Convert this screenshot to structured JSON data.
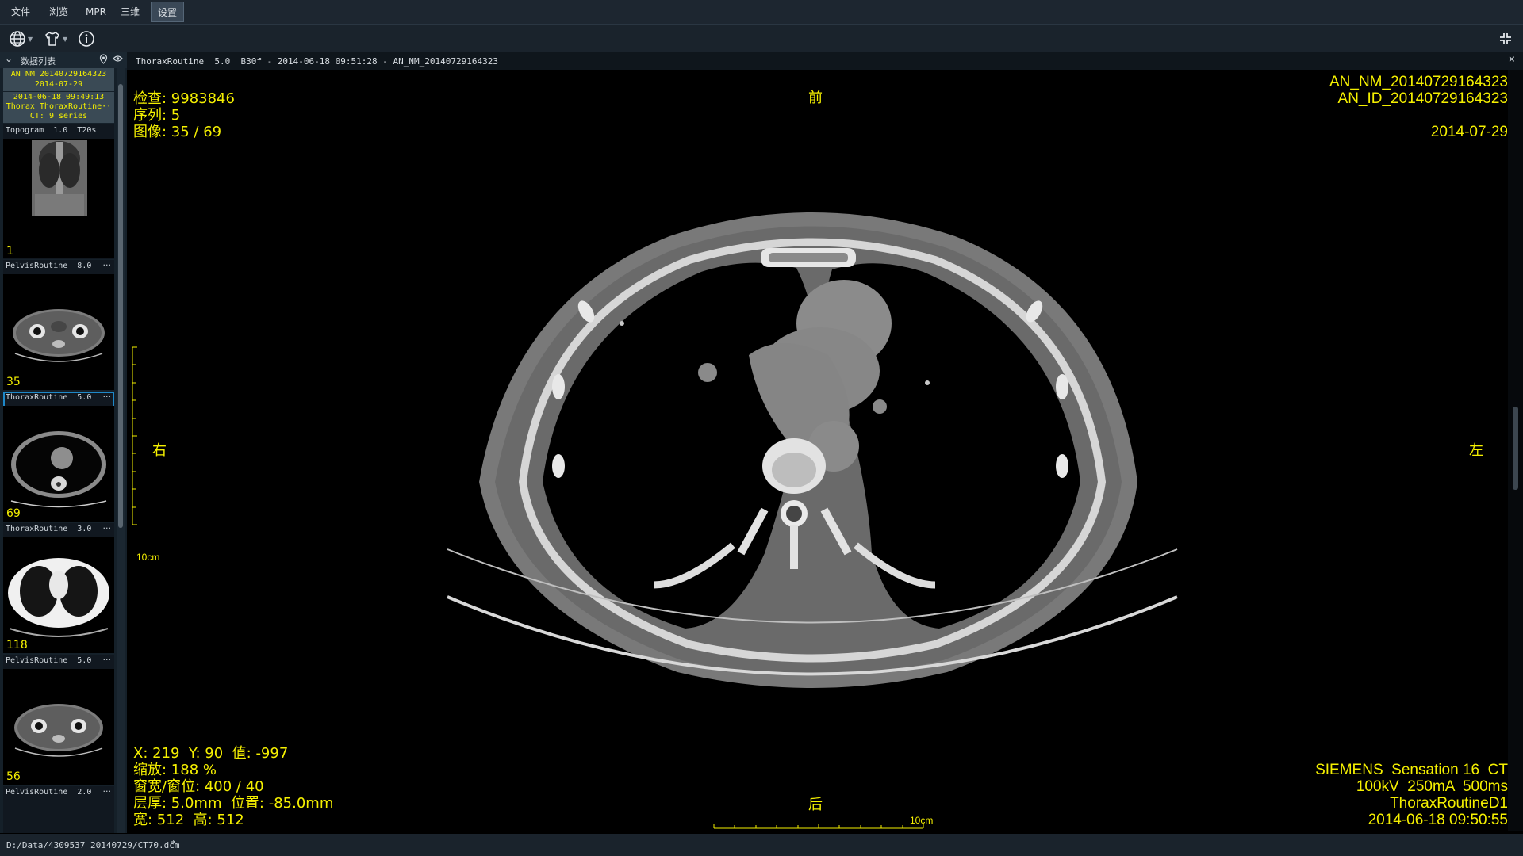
{
  "menu": {
    "items": [
      {
        "label": "文件"
      },
      {
        "label": "浏览"
      },
      {
        "label": "MPR"
      },
      {
        "label": "三维"
      },
      {
        "label": "设置",
        "active": true
      }
    ]
  },
  "toolbar": {
    "icons": [
      "globe-icon",
      "shirt-icon",
      "info-icon"
    ],
    "right_icon": "collapse-icon"
  },
  "left_panel": {
    "header_label": "数据列表",
    "patient": {
      "line1": "AN_NM_20140729164323",
      "line2": "2014-07-29"
    },
    "study": {
      "line1": "2014-06-18  09:49:13",
      "line2": "Thorax ThoraxRoutine··",
      "line3": "CT: 9 series"
    },
    "series": [
      {
        "title": "Topogram  1.0  T20s",
        "count": "1"
      },
      {
        "title": "PelvisRoutine  8.0",
        "count": "35"
      },
      {
        "title": "ThoraxRoutine  5.0",
        "count": "69",
        "selected": true
      },
      {
        "title": "ThoraxRoutine  3.0",
        "count": "118"
      },
      {
        "title": "PelvisRoutine  5.0",
        "count": "56"
      },
      {
        "title": "PelvisRoutine  2.0",
        "count": ""
      }
    ]
  },
  "viewer": {
    "title": "ThoraxRoutine  5.0  B30f - 2014-06-18 09:51:28 - AN_NM_20140729164323",
    "overlay": {
      "top_left": {
        "exam": "检查: 9983846",
        "series": "序列: 5",
        "image": "图像: 35 / 69"
      },
      "top_right": {
        "name": "AN_NM_20140729164323",
        "id": "AN_ID_20140729164323",
        "date": "2014-07-29"
      },
      "bottom_left": {
        "coords": "X: 219  Y: 90  值: -997",
        "zoom": "缩放: 188 %",
        "window": "窗宽/窗位: 400 / 40",
        "slice": "层厚: 5.0mm  位置: -85.0mm",
        "size": "宽: 512  高: 512"
      },
      "bottom_right": {
        "scanner": "SIEMENS  Sensation 16  CT",
        "params": "100kV  250mA  500ms",
        "protocol": "ThoraxRoutineD1",
        "datetime": "2014-06-18 09:50:55"
      },
      "orient": {
        "anterior": "前",
        "posterior": "后",
        "right": "右",
        "left": "左"
      },
      "scale_label_v": "10cm",
      "scale_label_h": "10cm"
    }
  },
  "status": {
    "path": "D:/Data/4309537_20140729/CT70.dcm"
  }
}
